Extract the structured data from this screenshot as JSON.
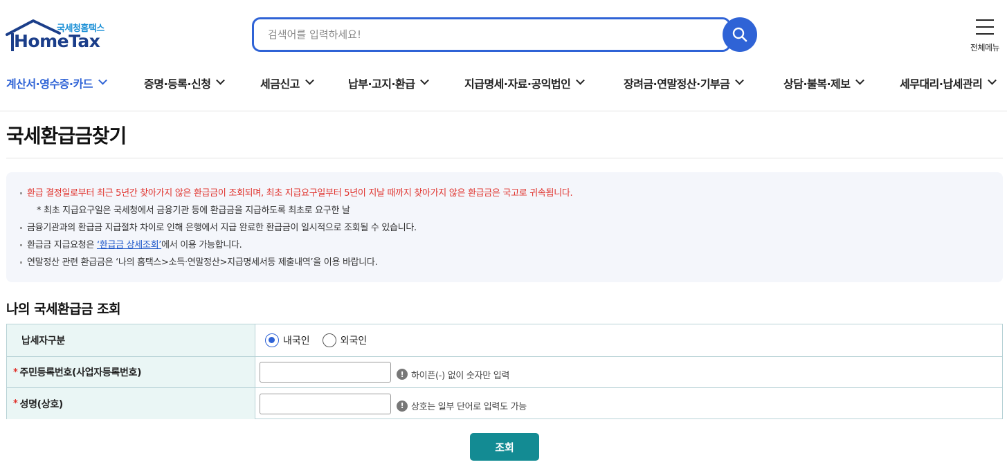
{
  "header": {
    "logo_sub": "국세청홈택스",
    "logo_main": "HomeTax",
    "search_placeholder": "검색어를 입력하세요!",
    "all_menu_label": "전체메뉴"
  },
  "nav": [
    {
      "label": "계산서·영수증·카드",
      "active": true
    },
    {
      "label": "증명·등록·신청"
    },
    {
      "label": "세금신고"
    },
    {
      "label": "납부·고지·환급"
    },
    {
      "label": "지급명세·자료·공익법인"
    },
    {
      "label": "장려금·연말정산·기부금"
    },
    {
      "label": "상담·불복·제보"
    },
    {
      "label": "세무대리·납세관리"
    }
  ],
  "page_title": "국세환급금찾기",
  "notice": {
    "line1": "환급 결정일로부터 최근 5년간 찾아가지 않은 환급금이 조회되며, 최초 지급요구일부터 5년이 지날 때까지 찾아가지 않은 환급금은 국고로 귀속됩니다.",
    "line2": "* 최초 지급요구일은 국세청에서 금융기관 등에 환급금을 지급하도록 최초로 요구한 날",
    "line3": "금융기관과의 환급금 지급절차 차이로 인해 은행에서 지급 완료한 환급금이 일시적으로 조회될 수 있습니다.",
    "line4_pre": "환급금 지급요청은 ",
    "line4_link": "‘환급금 상세조회’",
    "line4_post": "에서 이용 가능합니다.",
    "line5": "연말정산 관련 환급금은 ‘나의 홈택스>소득·연말정산>지급명세서등 제출내역’을 이용 바랍니다."
  },
  "section_title": "나의 국세환급금 조회",
  "form": {
    "taxpayer_type_label": "납세자구분",
    "radio_domestic": "내국인",
    "radio_foreign": "외국인",
    "selected": "내국인",
    "required_mark": "*",
    "resident_no_label": "주민등록번호(사업자등록번호)",
    "resident_no_value": "",
    "resident_no_hint": "하이픈(-) 없이 숫자만 입력",
    "name_label": "성명(상호)",
    "name_value": "",
    "name_hint": "상호는 일부 단어로 입력도 가능",
    "info_icon_glyph": "!"
  },
  "submit_label": "조회",
  "colors": {
    "primary_blue": "#2f63d6",
    "brand_navy": "#1b3e8a",
    "notice_red": "#e0312b",
    "button_teal": "#138b93",
    "table_header_bg": "#eaf6f5"
  },
  "icons": {
    "search": "magnifier-icon",
    "menu": "hamburger-icon",
    "info": "info-circle-icon",
    "chevron": "chevron-down-icon"
  }
}
